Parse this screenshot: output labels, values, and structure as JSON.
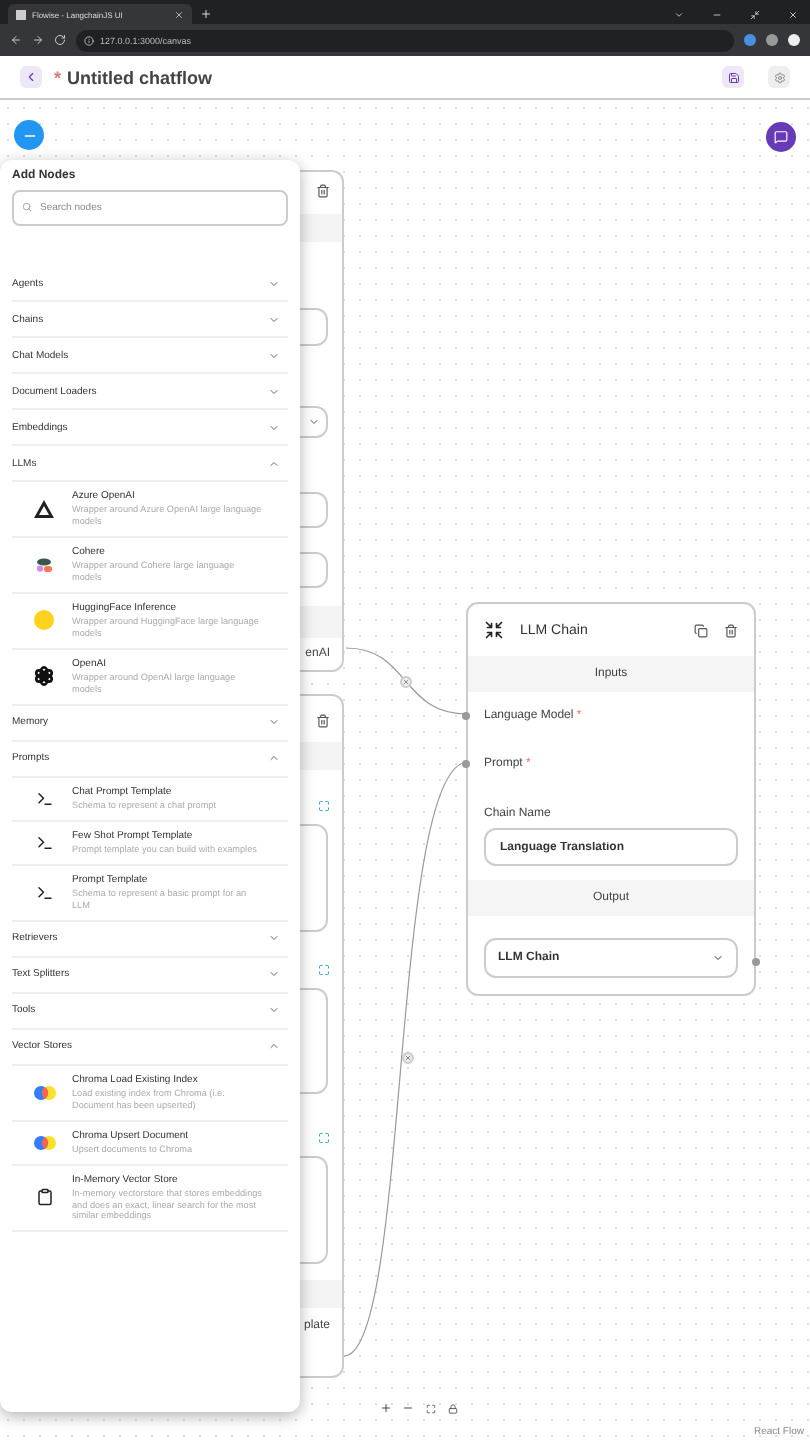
{
  "browser": {
    "tab_title": "Flowise - LangchainJS UI",
    "url": "127.0.0.1:3000/canvas"
  },
  "header": {
    "unsaved_mark": "*",
    "title": "Untitled chatflow"
  },
  "add_nodes": {
    "title": "Add Nodes",
    "search": {
      "placeholder": "Search nodes"
    },
    "categories": [
      {
        "name": "Agents",
        "expanded": false
      },
      {
        "name": "Chains",
        "expanded": false
      },
      {
        "name": "Chat Models",
        "expanded": false
      },
      {
        "name": "Document Loaders",
        "expanded": false
      },
      {
        "name": "Embeddings",
        "expanded": false
      },
      {
        "name": "LLMs",
        "expanded": true,
        "nodes": [
          {
            "kind": "azure",
            "name": "Azure OpenAI",
            "description": "Wrapper around Azure OpenAI large language models"
          },
          {
            "kind": "cohere",
            "name": "Cohere",
            "description": "Wrapper around Cohere large language models"
          },
          {
            "kind": "hugging",
            "name": "HuggingFace Inference",
            "description": "Wrapper around HuggingFace large language models"
          },
          {
            "kind": "openai",
            "name": "OpenAI",
            "description": "Wrapper around OpenAI large language models"
          }
        ]
      },
      {
        "name": "Memory",
        "expanded": false
      },
      {
        "name": "Prompts",
        "expanded": true,
        "nodes": [
          {
            "kind": "terminal",
            "name": "Chat Prompt Template",
            "description": "Schema to represent a chat prompt"
          },
          {
            "kind": "terminal",
            "name": "Few Shot Prompt Template",
            "description": "Prompt template you can build with examples"
          },
          {
            "kind": "terminal",
            "name": "Prompt Template",
            "description": "Schema to represent a basic prompt for an LLM"
          }
        ]
      },
      {
        "name": "Retrievers",
        "expanded": false
      },
      {
        "name": "Text Splitters",
        "expanded": false
      },
      {
        "name": "Tools",
        "expanded": false
      },
      {
        "name": "Vector Stores",
        "expanded": true,
        "nodes": [
          {
            "kind": "chroma",
            "name": "Chroma Load Existing Index",
            "description": "Load existing index from Chroma (i.e: Document has been upserted)"
          },
          {
            "kind": "chroma",
            "name": "Chroma Upsert Document",
            "description": "Upsert documents to Chroma"
          },
          {
            "kind": "clipboard",
            "name": "In-Memory Vector Store",
            "description": "In-memory vectorstore that stores embeddings and does an exact, linear search for the most similar embeddings"
          }
        ]
      }
    ]
  },
  "canvas": {
    "partial_nodes": [
      {
        "output_label": "enAI"
      },
      {
        "output_label": "plate"
      }
    ],
    "llm_node": {
      "title": "LLM Chain",
      "inputs_heading": "Inputs",
      "inputs": [
        {
          "label": "Language Model",
          "required_mark": "*"
        },
        {
          "label": "Prompt",
          "required_mark": "*"
        }
      ],
      "field": {
        "label": "Chain Name",
        "value": "Language Translation"
      },
      "output_heading": "Output",
      "output": {
        "value": "LLM Chain"
      }
    },
    "attribution": "React Flow"
  }
}
